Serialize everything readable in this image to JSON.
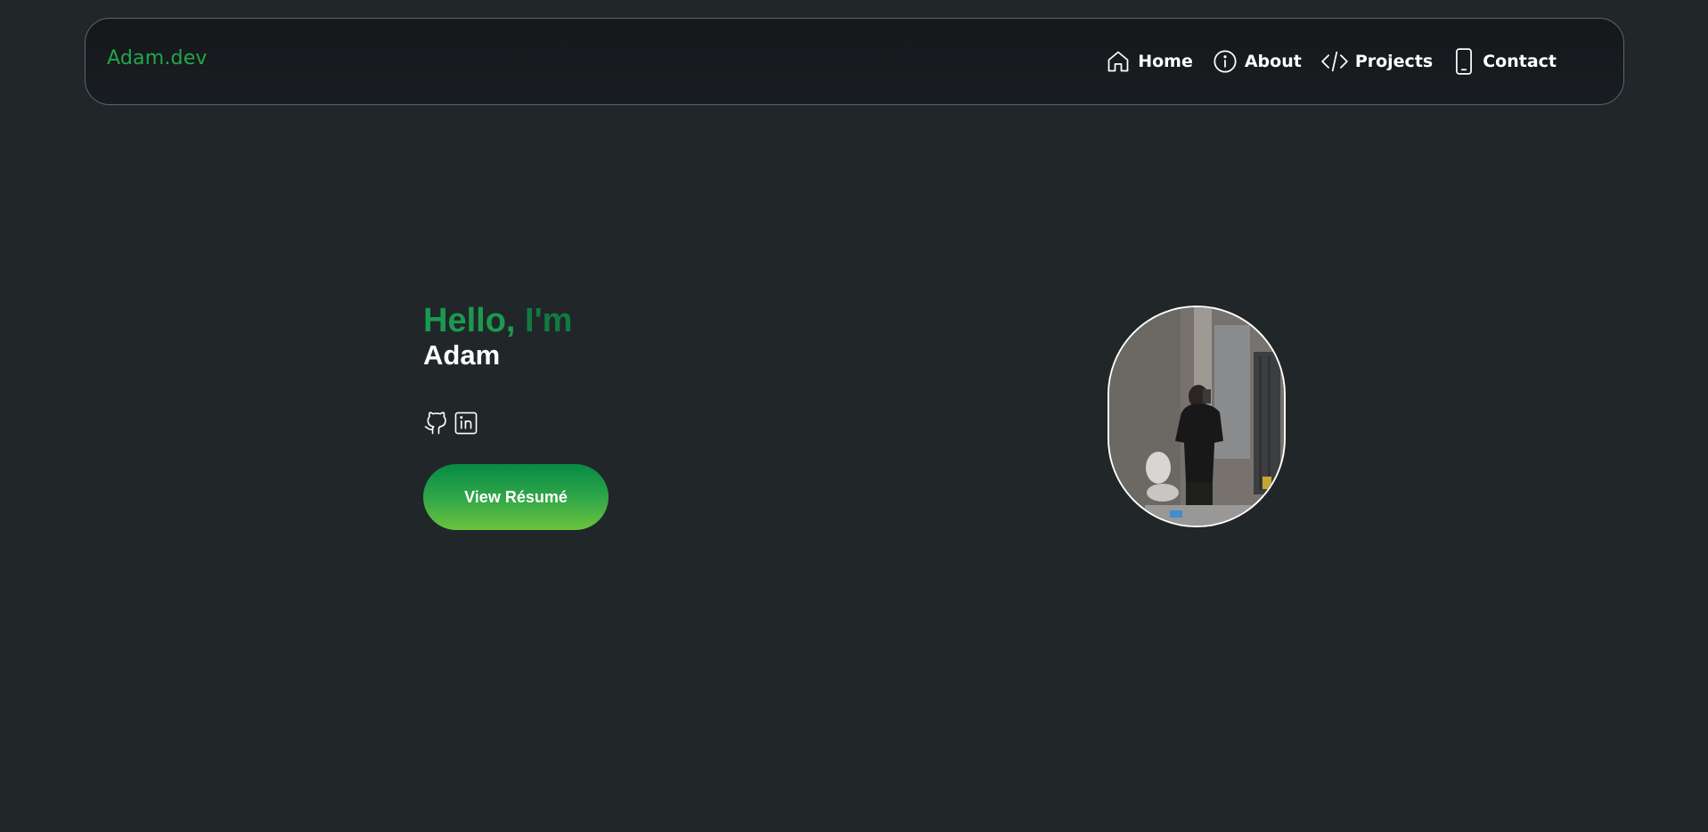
{
  "nav": {
    "brand": "Adam.dev",
    "links": [
      {
        "label": "Home",
        "icon": "home-icon"
      },
      {
        "label": "About",
        "icon": "info-icon"
      },
      {
        "label": "Projects",
        "icon": "code-icon"
      },
      {
        "label": "Contact",
        "icon": "phone-icon"
      }
    ]
  },
  "hero": {
    "greeting_part1": "Hello,",
    "greeting_part2": " I'm",
    "name": "Adam",
    "socials": [
      {
        "icon": "github-icon"
      },
      {
        "icon": "linkedin-icon"
      }
    ],
    "resume_label": "View Résumé",
    "portrait_icon": "profile-photo"
  },
  "colors": {
    "background": "#212629",
    "accent": "#23a64b",
    "nav_border": "#5b6570",
    "text": "#ffffff"
  }
}
